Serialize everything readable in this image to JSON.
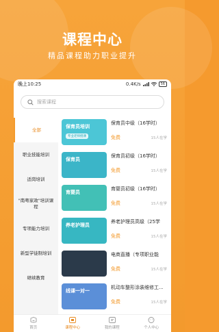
{
  "promo": {
    "title": "课程中心",
    "subtitle": "精品课程助力职业提升"
  },
  "status": {
    "time": "晚上10:25",
    "network": "0.4K/s",
    "battery": "56"
  },
  "search": {
    "placeholder": "搜索课程"
  },
  "categories": [
    {
      "label": "全部",
      "active": true
    },
    {
      "label": "职业技能培训",
      "active": false
    },
    {
      "label": "适岗培训",
      "active": false
    },
    {
      "label": "\"南粤家政\"培训课程",
      "active": false
    },
    {
      "label": "专项能力培训",
      "active": false
    },
    {
      "label": "新型学徒制培训",
      "active": false
    },
    {
      "label": "继续教育",
      "active": false
    }
  ],
  "courses": [
    {
      "title": "保育员中级（16学时）",
      "price": "免费",
      "learners": "15人在学",
      "thumb_text": "保育员培训",
      "thumb_tag": "专业老师授课",
      "thumb_color": "#4cc6d6"
    },
    {
      "title": "保育员初级（16学时）",
      "price": "免费",
      "learners": "15人在学",
      "thumb_text": "保育员",
      "thumb_tag": "",
      "thumb_color": "#3bb5c8"
    },
    {
      "title": "育婴员初级（16学时）",
      "price": "免费",
      "learners": "15人在学",
      "thumb_text": "育婴员",
      "thumb_tag": "",
      "thumb_color": "#42c0b6"
    },
    {
      "title": "养老护理员高级（25学",
      "price": "免费",
      "learners": "15人在学",
      "thumb_text": "养老护理员",
      "thumb_tag": "",
      "thumb_color": "#37b7c2"
    },
    {
      "title": "电商直播（专项职业能",
      "price": "免费",
      "learners": "15人在学",
      "thumb_text": "",
      "thumb_tag": "",
      "thumb_color": "#2b3a4a"
    },
    {
      "title": "机动车整形涂装维修工...",
      "price": "免费",
      "learners": "15人在学",
      "thumb_text": "线课一对一",
      "thumb_tag": "",
      "thumb_color": "#5b8fd8"
    }
  ],
  "tabs": [
    {
      "label": "首页",
      "icon": "home-icon",
      "active": false
    },
    {
      "label": "课程中心",
      "icon": "course-center-icon",
      "active": true
    },
    {
      "label": "我的课程",
      "icon": "my-courses-icon",
      "active": false
    },
    {
      "label": "个人中心",
      "icon": "profile-icon",
      "active": false
    }
  ],
  "colors": {
    "accent": "#f39a2d",
    "accent_dark": "#e88a1f"
  }
}
